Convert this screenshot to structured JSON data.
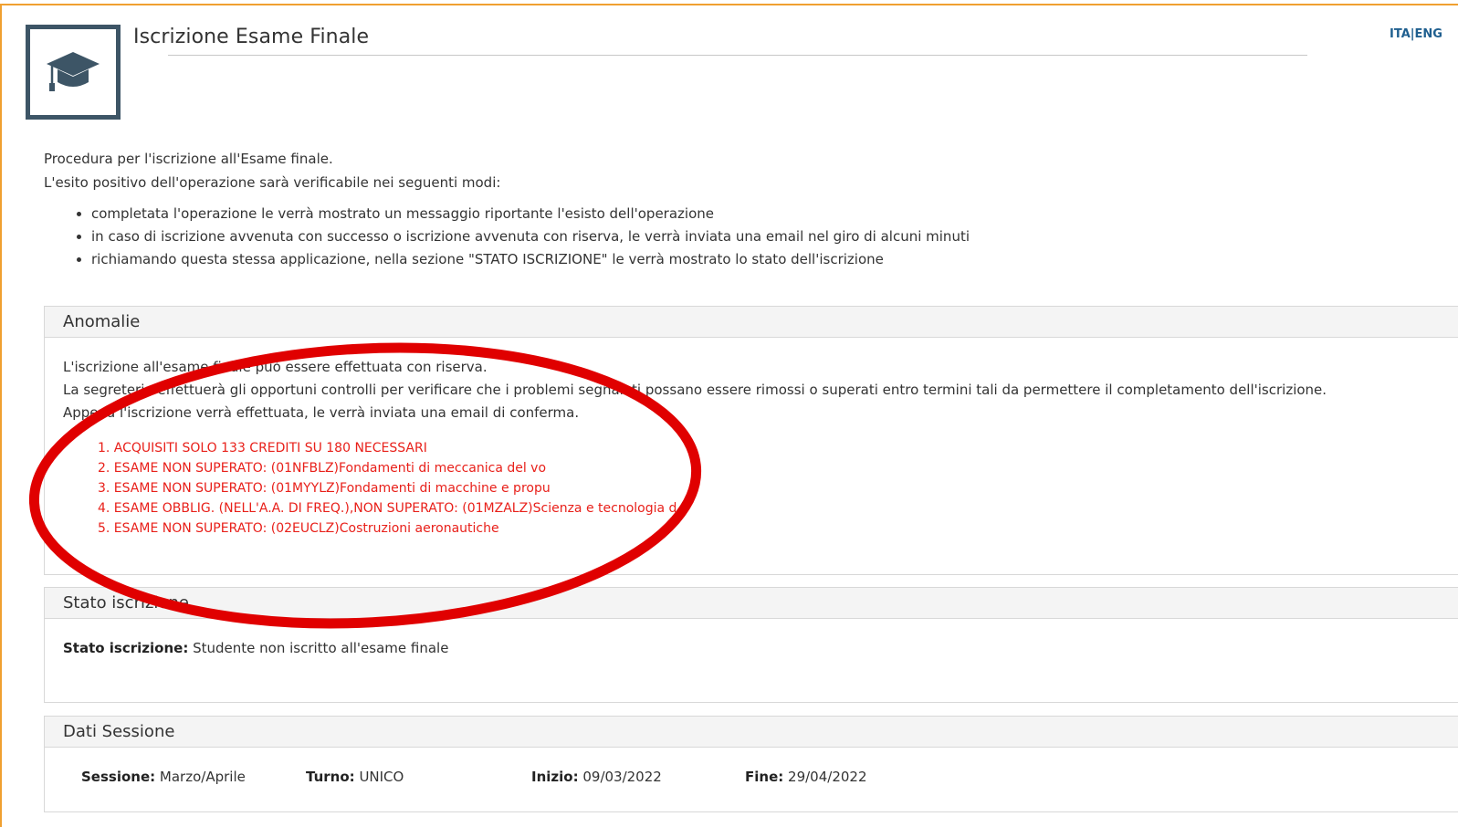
{
  "header": {
    "title": "Iscrizione Esame Finale",
    "lang_ita": "ITA",
    "lang_sep": "|",
    "lang_eng": "ENG"
  },
  "intro": {
    "line1": "Procedura per l'iscrizione all'Esame finale.",
    "line2": "L'esito positivo dell'operazione sarà verificabile nei seguenti modi:",
    "bullets": [
      "completata l'operazione le verrà mostrato un messaggio riportante l'esisto dell'operazione",
      "in caso di iscrizione avvenuta con successo o iscrizione avvenuta con riserva, le verrà inviata una email nel giro di alcuni minuti",
      "richiamando questa stessa applicazione, nella sezione \"STATO ISCRIZIONE\" le verrà mostrato lo stato dell'iscrizione"
    ]
  },
  "anomalie": {
    "title": "Anomalie",
    "text": [
      "L'iscrizione all'esame finale può essere effettuata con riserva.",
      "La segreteria effettuerà gli opportuni controlli per verificare che i problemi segnalati possano essere rimossi o superati entro termini tali da permettere il completamento dell'iscrizione.",
      "Appena l'iscrizione verrà effettuata, le verrà inviata una email di conferma."
    ],
    "items": [
      "1. ACQUISITI SOLO 133 CREDITI SU 180 NECESSARI",
      "2. ESAME NON SUPERATO: (01NFBLZ)Fondamenti di meccanica del vo",
      "3. ESAME NON SUPERATO: (01MYYLZ)Fondamenti di macchine e propu",
      "4. ESAME OBBLIG. (NELL'A.A. DI FREQ.),NON SUPERATO: (01MZALZ)Scienza e tecnologia d",
      "5. ESAME NON SUPERATO: (02EUCLZ)Costruzioni aeronautiche"
    ]
  },
  "stato": {
    "title": "Stato iscrizione",
    "label": "Stato iscrizione:",
    "value": "Studente non iscritto all'esame finale"
  },
  "dati": {
    "title": "Dati Sessione",
    "sessione_label": "Sessione:",
    "sessione_value": "Marzo/Aprile",
    "turno_label": "Turno:",
    "turno_value": "UNICO",
    "inizio_label": "Inizio:",
    "inizio_value": "09/03/2022",
    "fine_label": "Fine:",
    "fine_value": "29/04/2022"
  },
  "colors": {
    "accent_frame": "#f0a030",
    "icon_border": "#3d5566",
    "error_red": "#e8201a",
    "annotation_red": "#e00000",
    "link_blue": "#1f5f8f"
  },
  "icons": {
    "header_icon": "graduation-cap-icon"
  }
}
